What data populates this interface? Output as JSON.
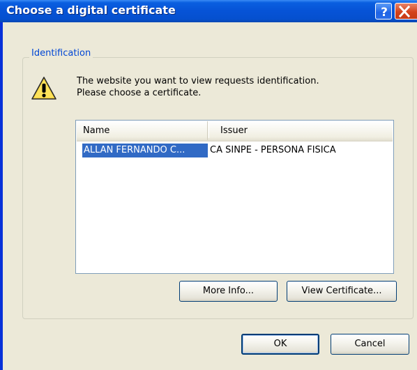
{
  "window": {
    "title": "Choose a digital certificate",
    "help_label": "?",
    "close_label": "X"
  },
  "group": {
    "legend": "Identification"
  },
  "message": {
    "line1": "The website you want to view requests identification.",
    "line2": "Please choose a certificate."
  },
  "certificate_list": {
    "columns": [
      "Name",
      "Issuer"
    ],
    "rows": [
      {
        "name": "ALLAN FERNANDO C...",
        "issuer": "CA SINPE - PERSONA FISICA",
        "selected": true
      }
    ]
  },
  "buttons": {
    "more_info": "More Info...",
    "view_certificate": "View Certificate...",
    "ok": "OK",
    "cancel": "Cancel"
  },
  "colors": {
    "titlebar": "#0653d6",
    "selection": "#316ac5",
    "legend_text": "#0046d5",
    "dialog_bg": "#ece9d8"
  },
  "icons": {
    "warning": "warning-icon",
    "help": "help-icon",
    "close": "close-icon"
  }
}
